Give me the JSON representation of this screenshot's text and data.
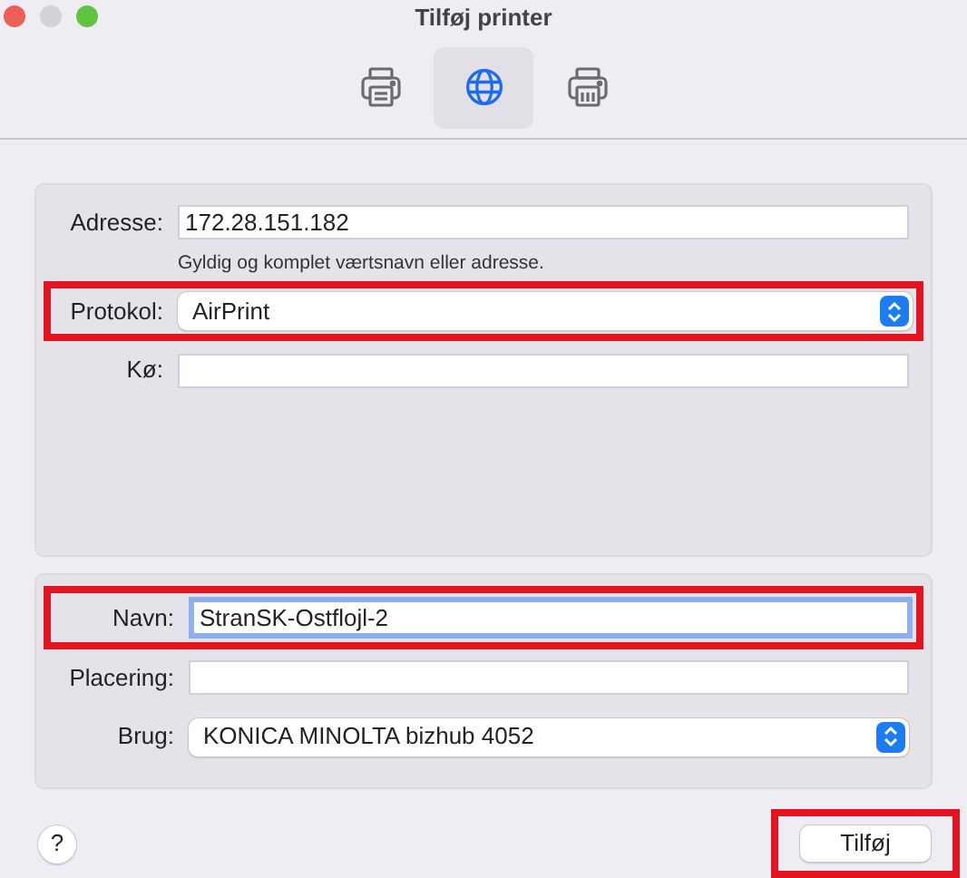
{
  "window": {
    "title": "Tilføj printer"
  },
  "toolbar": [
    {
      "kind": "printer",
      "selected": false
    },
    {
      "kind": "globe",
      "selected": true
    },
    {
      "kind": "fax",
      "selected": false
    }
  ],
  "connection": [
    {
      "kind": "text",
      "label": "Adresse:",
      "value": "172.28.151.182",
      "hint": "Gyldig og komplet værtsnavn eller adresse.",
      "highlighted": false
    },
    {
      "kind": "popup",
      "label": "Protokol:",
      "value": "AirPrint",
      "highlighted": true
    },
    {
      "kind": "text",
      "label": "Kø:",
      "highlighted": false
    }
  ],
  "details": [
    {
      "kind": "text",
      "label": "Navn:",
      "value": "StranSK-Ostflojl-2",
      "highlighted": true,
      "focused": true
    },
    {
      "kind": "text",
      "label": "Placering:",
      "highlighted": false
    },
    {
      "kind": "popup",
      "label": "Brug:",
      "value": "KONICA MINOLTA bizhub 4052",
      "highlighted": false
    }
  ],
  "help_button": {
    "label": "?"
  },
  "add_button": {
    "label": "Tilføj",
    "highlighted": true
  }
}
